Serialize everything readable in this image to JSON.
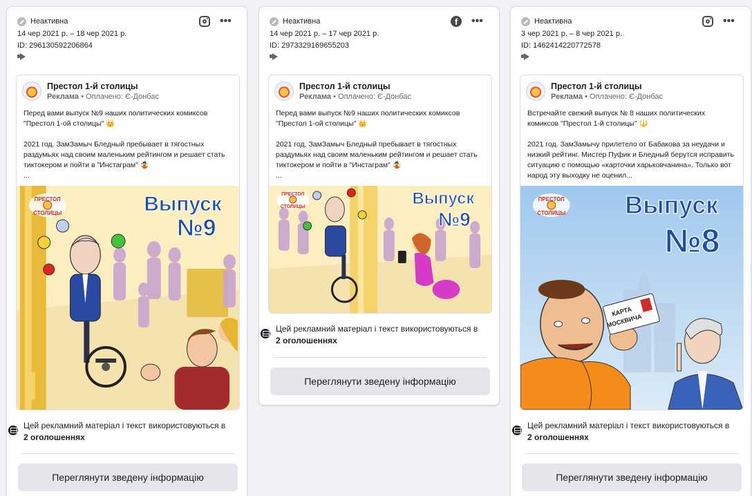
{
  "cards": [
    {
      "status": "Неактивна",
      "dates": "14 чер 2021 р. – 18 чер 2021 р.",
      "ad_id": "ID: 296130592206864",
      "platform_icon": "instagram-icon",
      "page_name": "Престол 1-й столицы",
      "sponsored": "Реклама",
      "paid_by": "Оплачено: Є-Донбас",
      "text": "Перед вами выпуск №9 наших политических комиксов \"Престол 1-ой столицы\" 👑\n\n2021 год. ЗамЗамыч Бледный пребывает в тягостных раздумьях над своим маленьким рейтингом и решает стать тиктокером и пойти в \"Инстаграм\" 🤹\n...",
      "creative_title": "Выпуск",
      "creative_number": "№9",
      "creative_logo": "ПРЕСТОЛ СТОЛИЦЫ",
      "used_text": "Цей рекламний матеріал і текст використовуються в",
      "used_count": "2 оголошеннях",
      "button": "Переглянути зведену інформацію"
    },
    {
      "status": "Неактивна",
      "dates": "14 чер 2021 р. – 17 чер 2021 р.",
      "ad_id": "ID: 2973329169655203",
      "platform_icon": "facebook-icon",
      "page_name": "Престол 1-й столицы",
      "sponsored": "Реклама",
      "paid_by": "Оплачено: Є-Донбас",
      "text": "Перед вами выпуск №9 наших политических комиксов \"Престол 1-ой столицы\" 👑\n\n2021 год. ЗамЗамыч Бледный пребывает в тягостных раздумьях над своим маленьким рейтингом и решает стать тиктокером и пойти в \"Инстаграм\" 🤹\n...",
      "creative_title": "Выпуск",
      "creative_number": "№9",
      "creative_logo": "ПРЕСТОЛ СТОЛИЦЫ",
      "used_text": "Цей рекламний матеріал і текст використовуються в",
      "used_count": "2 оголошеннях",
      "button": "Переглянути зведену інформацію"
    },
    {
      "status": "Неактивна",
      "dates": "3 чер 2021 р. – 8 чер 2021 р.",
      "ad_id": "ID: 1462414220772578",
      "platform_icon": "instagram-icon",
      "page_name": "Престол 1-й столицы",
      "sponsored": "Реклама",
      "paid_by": "Оплачено: Є-Донбас",
      "text": "Встречайте свежий выпуск № 8 наших политических комиксов \"Престол 1-й столицы\" 🔱\n\n2021 год. ЗамЗамычу прилетело от Бабакова за неудачи и низкий рейтинг. Мистер Пуфик и Бледный берутся исправить ситуацию с помощью «карточки харьковчанина». Только вот народ эту выходку не оценил...",
      "creative_title": "Выпуск",
      "creative_number": "№8",
      "creative_logo": "ПРЕСТОЛ СТОЛИЦЫ",
      "creative_card": "КАРТА МОСКВИЧА",
      "used_text": "Цей рекламний матеріал і текст використовуються в",
      "used_count": "2 оголошеннях",
      "button": "Переглянути зведену інформацію"
    }
  ],
  "colors": {
    "accent": "#1877f2",
    "button_bg": "#e4e6eb",
    "title_blue": "#1e4fa8"
  }
}
